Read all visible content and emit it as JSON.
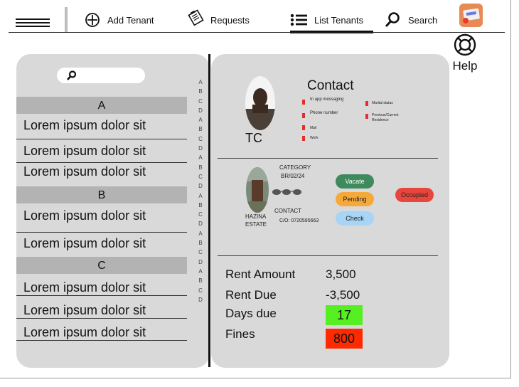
{
  "nav": {
    "add_tenant": "Add Tenant",
    "requests": "Requests",
    "list_tenants": "List Tenants",
    "search": "Search",
    "help": "Help"
  },
  "sections": [
    {
      "letter": "A",
      "items": [
        "Lorem ipsum dolor sit",
        "Lorem ipsum dolor sit",
        "Lorem ipsum dolor sit"
      ]
    },
    {
      "letter": "B",
      "items": [
        "Lorem ipsum dolor sit",
        "Lorem ipsum dolor sit"
      ]
    },
    {
      "letter": "C",
      "items": [
        "Lorem ipsum dolor sit",
        "Lorem ipsum dolor sit",
        "Lorem ipsum dolor sit"
      ]
    }
  ],
  "alpha_index": [
    "A",
    "B",
    "C",
    "D",
    "A",
    "B",
    "C",
    "D",
    "A",
    "B",
    "C",
    "D",
    "A",
    "B",
    "C",
    "D",
    "A",
    "B",
    "C",
    "D",
    "A",
    "B",
    "C",
    "D"
  ],
  "tenant": {
    "initials": "TC",
    "contact_title": "Contact",
    "contact_items": [
      "In app messaging",
      "Phone number",
      "Mail",
      "Work",
      "Marital status",
      "Previous/Current Residence"
    ]
  },
  "property": {
    "category_label": "CATEGORY",
    "category_value": "BR/02/24",
    "name": "HAZINA ESTATE",
    "contact_label": "CONTACT",
    "contact_value": "C/O: 0720595663",
    "status_badge": "Occupied"
  },
  "actions": {
    "vacate": "Vacate",
    "pending": "Pending",
    "check": "Check"
  },
  "finance": {
    "rent_amount_label": "Rent Amount",
    "rent_amount": "3,500",
    "rent_due_label": "Rent Due",
    "rent_due": "-3,500",
    "days_due_label": "Days due",
    "days_due": "17",
    "fines_label": "Fines",
    "fines": "800"
  },
  "colors": {
    "panel": "#d9d9d9",
    "section_header": "#b3b3b3",
    "vacate": "#3f8a5c",
    "pending": "#f6a93b",
    "check": "#a8d4f5",
    "occupied": "#e8453c",
    "days_due": "#55ef22",
    "fines": "#ff2a00"
  }
}
